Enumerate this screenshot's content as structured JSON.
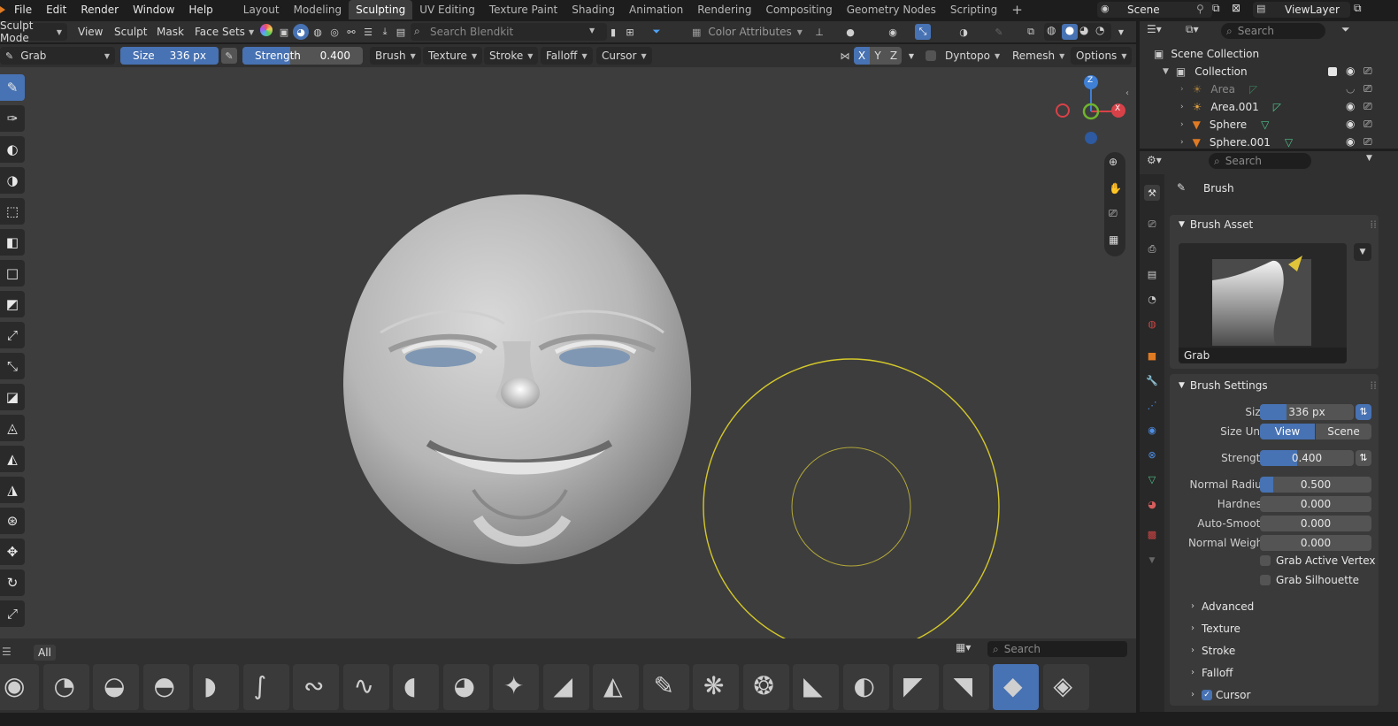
{
  "menu": [
    "File",
    "Edit",
    "Render",
    "Window",
    "Help"
  ],
  "workspaces": [
    "Layout",
    "Modeling",
    "Sculpting",
    "UV Editing",
    "Texture Paint",
    "Shading",
    "Animation",
    "Rendering",
    "Compositing",
    "Geometry Nodes",
    "Scripting"
  ],
  "active_workspace": "Sculpting",
  "scene": "Scene",
  "view_layer": "ViewLayer",
  "header": {
    "mode": "Sculpt Mode",
    "menus": [
      "View",
      "Sculpt",
      "Mask",
      "Face Sets"
    ],
    "search_placeholder": "Search Blendkit",
    "color_attributes": "Color Attributes"
  },
  "tool_settings": {
    "brush": "Grab",
    "size_label": "Size",
    "size_value": "336 px",
    "strength_label": "Strength",
    "strength_value": "0.400",
    "strength_fraction": 0.4,
    "menus": [
      "Brush",
      "Texture",
      "Stroke",
      "Falloff",
      "Cursor"
    ],
    "axes": [
      "X",
      "Y",
      "Z"
    ],
    "dyntopo": "Dyntopo",
    "remesh": "Remesh",
    "options": "Options"
  },
  "gizmo": {
    "x": "X",
    "y": "Y",
    "z": "Z"
  },
  "asset_shelf": {
    "tab": "All",
    "search_placeholder": "Search"
  },
  "outliner": {
    "search_placeholder": "Search",
    "root": "Scene Collection",
    "collection": "Collection",
    "items": [
      "Area",
      "Area.001",
      "Sphere",
      "Sphere.001"
    ]
  },
  "properties": {
    "search_placeholder": "Search",
    "title": "Brush",
    "brush_asset": {
      "header": "Brush Asset",
      "name": "Grab"
    },
    "brush_settings": {
      "header": "Brush Settings",
      "size": {
        "label": "Size",
        "value": "336 px"
      },
      "size_unit": {
        "label": "Size Unit",
        "options": [
          "View",
          "Scene"
        ],
        "selected": "View"
      },
      "strength": {
        "label": "Strength",
        "value": "0.400",
        "fraction": 0.4
      },
      "normal_radius": {
        "label": "Normal Radius",
        "value": "0.500",
        "fraction": 0.12
      },
      "hardness": {
        "label": "Hardness",
        "value": "0.000"
      },
      "auto_smooth": {
        "label": "Auto-Smooth",
        "value": "0.000"
      },
      "normal_weight": {
        "label": "Normal Weight",
        "value": "0.000"
      },
      "grab_active_vertex": "Grab Active Vertex",
      "grab_silhouette": "Grab Silhouette"
    },
    "subpanels": [
      "Advanced",
      "Texture",
      "Stroke",
      "Falloff",
      "Cursor"
    ]
  },
  "colors": {
    "accent": "#4772b3",
    "cursor_ring": "#d4c82a",
    "eyes": "#7f97b3"
  }
}
